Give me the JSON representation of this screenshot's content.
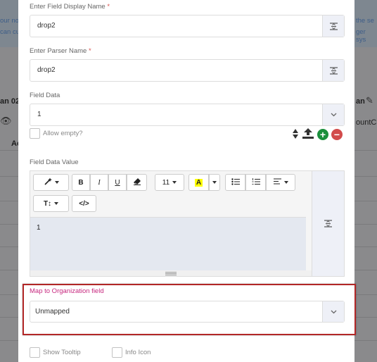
{
  "background": {
    "top_left_text_1": "our no",
    "top_left_text_2": "can cu",
    "top_right_text_1": "the se",
    "top_right_text_2": "ger sys",
    "left_col_heading": "an 02",
    "left_col_action": "Ac",
    "right_col_heading": "an",
    "right_col_sub": "ountCu"
  },
  "form": {
    "display_name": {
      "label": "Enter Field Display Name",
      "required_mark": "*",
      "value": "drop2"
    },
    "parser_name": {
      "label": "Enter Parser Name",
      "required_mark": "*",
      "value": "drop2"
    },
    "field_data": {
      "label": "Field Data",
      "value": "1"
    },
    "allow_empty": {
      "label": "Allow empty?",
      "checked": false
    },
    "field_data_value": {
      "label": "Field Data Value",
      "toolbar": {
        "font_size": "11",
        "bold": "B",
        "italic": "I",
        "underline": "U",
        "text_color_letter": "A",
        "line_height": "T↕",
        "code_view": "</>"
      },
      "content": "1"
    },
    "org_field": {
      "label": "Map to Organization field",
      "value": "Unmapped"
    },
    "show_tooltip": {
      "label": "Show Tooltip",
      "checked": false
    },
    "info_icon": {
      "label": "Info Icon",
      "checked": false
    }
  },
  "colors": {
    "accent_pink": "#c7287f",
    "highlight_red": "#b22727",
    "add_green": "#1a8f3c",
    "remove_red": "#d24b4b",
    "highlight_yellow": "#ffff00"
  }
}
